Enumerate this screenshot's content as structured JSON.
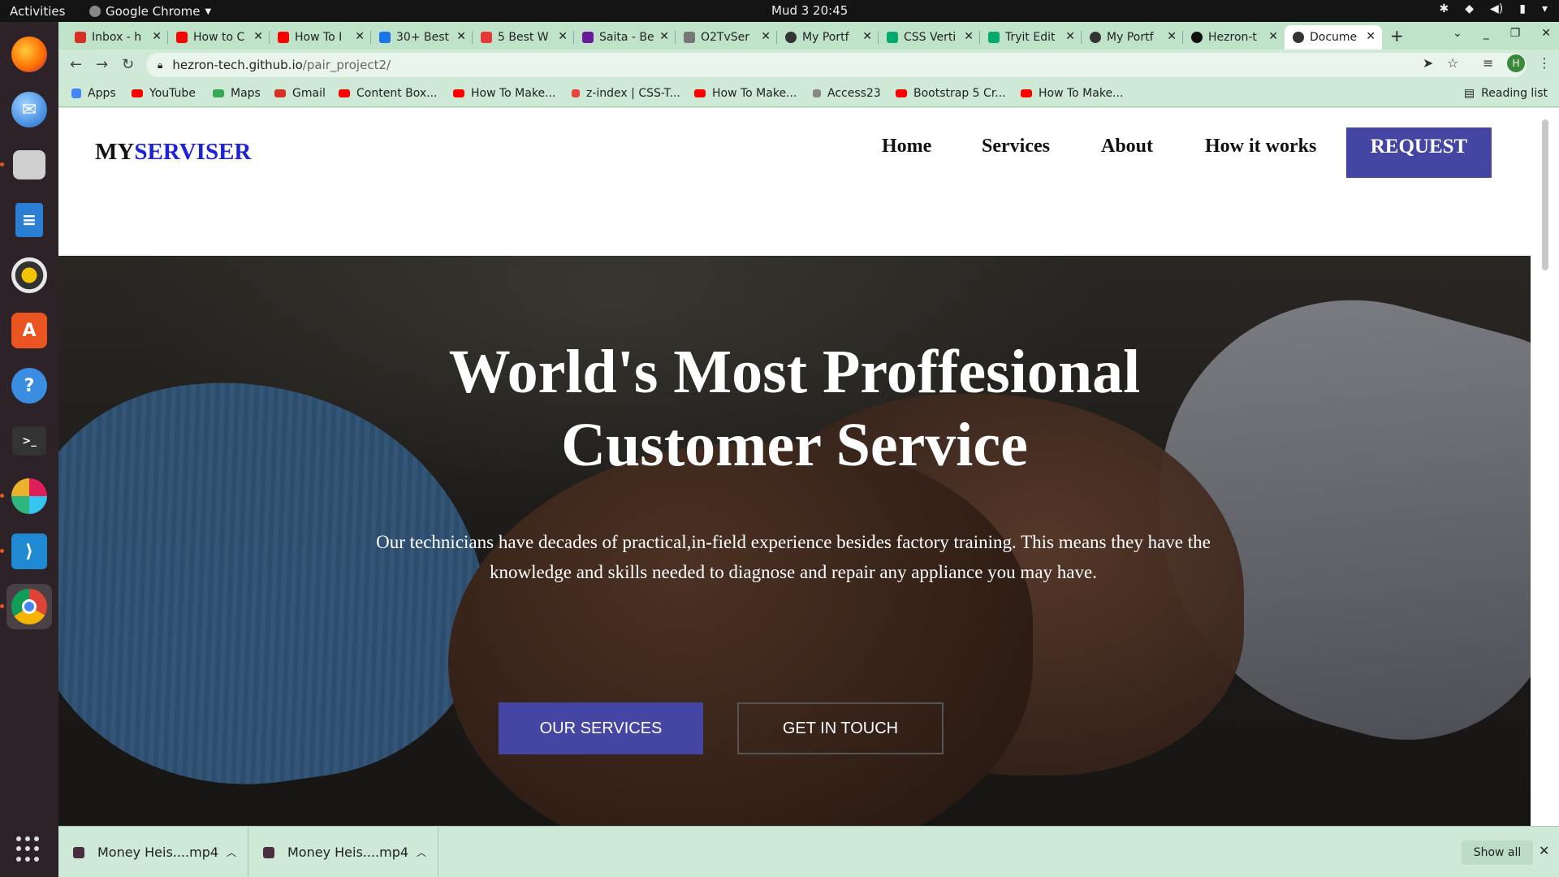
{
  "os": {
    "activities": "Activities",
    "app_name": "Google Chrome",
    "clock": "Mud 3  20:45"
  },
  "browser": {
    "tabs": [
      {
        "label": "Inbox - h",
        "color": "#d93025"
      },
      {
        "label": "How to C",
        "color": "#ff0000"
      },
      {
        "label": "How To I",
        "color": "#ff0000"
      },
      {
        "label": "30+ Best",
        "color": "#1a73e8"
      },
      {
        "label": "5 Best W",
        "color": "#e53935"
      },
      {
        "label": "Saita - Be",
        "color": "#6a1b9a"
      },
      {
        "label": "O2TvSer",
        "color": "#777777"
      },
      {
        "label": "My Portf",
        "color": "#333333"
      },
      {
        "label": "CSS Verti",
        "color": "#04aa6d"
      },
      {
        "label": "Tryit Edit",
        "color": "#04aa6d"
      },
      {
        "label": "My Portf",
        "color": "#333333"
      },
      {
        "label": "Hezron-t",
        "color": "#111111"
      },
      {
        "label": "Docume",
        "color": "#333333",
        "active": true
      }
    ],
    "url_host": "hezron-tech.github.io",
    "url_path": "/pair_project2/",
    "profile_initial": "H",
    "bookmarks": [
      {
        "label": "Apps",
        "color": "#4285f4"
      },
      {
        "label": "YouTube",
        "color": "#ff0000"
      },
      {
        "label": "Maps",
        "color": "#34a853"
      },
      {
        "label": "Gmail",
        "color": "#d93025"
      },
      {
        "label": "Content Box...",
        "color": "#ff0000"
      },
      {
        "label": "How To Make...",
        "color": "#ff0000"
      },
      {
        "label": "z-index | CSS-T...",
        "color": "#e8453c"
      },
      {
        "label": "How To Make...",
        "color": "#ff0000"
      },
      {
        "label": "Access23",
        "color": "#888888"
      },
      {
        "label": "Bootstrap 5 Cr...",
        "color": "#ff0000"
      },
      {
        "label": "How To Make...",
        "color": "#ff0000"
      }
    ],
    "reading_list": "Reading list"
  },
  "site": {
    "logo_part1": "MY",
    "logo_part2": "SERVISER",
    "nav": [
      "Home",
      "Services",
      "About",
      "How it works"
    ],
    "request": "REQUEST",
    "hero_title_line1": "World's Most Proffesional",
    "hero_title_line2": "Customer Service",
    "hero_text": "Our technicians have decades of practical,in-field experience besides factory training. This means they have the knowledge and skills needed to diagnose and repair any appliance you may have.",
    "btn_services": "OUR SERVICES",
    "btn_touch": "GET IN TOUCH"
  },
  "downloads": {
    "items": [
      "Money Heis....mp4",
      "Money Heis....mp4"
    ],
    "show_all": "Show all"
  },
  "colors": {
    "brand_blue": "#1d22d6",
    "button_indigo": "#4546a3"
  }
}
